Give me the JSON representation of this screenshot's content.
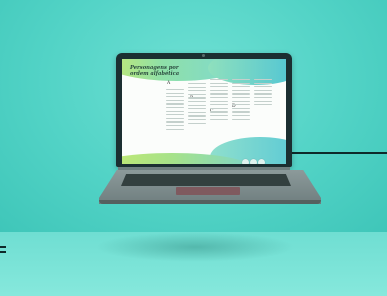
{
  "scene": {
    "description_visible_only": true
  },
  "screen": {
    "title_line1": "Personagens por",
    "title_line2": "ordem alfabética",
    "letters": [
      "A",
      "B",
      "C",
      "D"
    ],
    "nav_buttons": [
      "prev",
      "home",
      "next"
    ]
  },
  "colors": {
    "background": "#52d3c6",
    "laptop_lid": "#1b2f31",
    "accent_green": "#c8ea6e",
    "accent_teal": "#4cc3d6"
  }
}
